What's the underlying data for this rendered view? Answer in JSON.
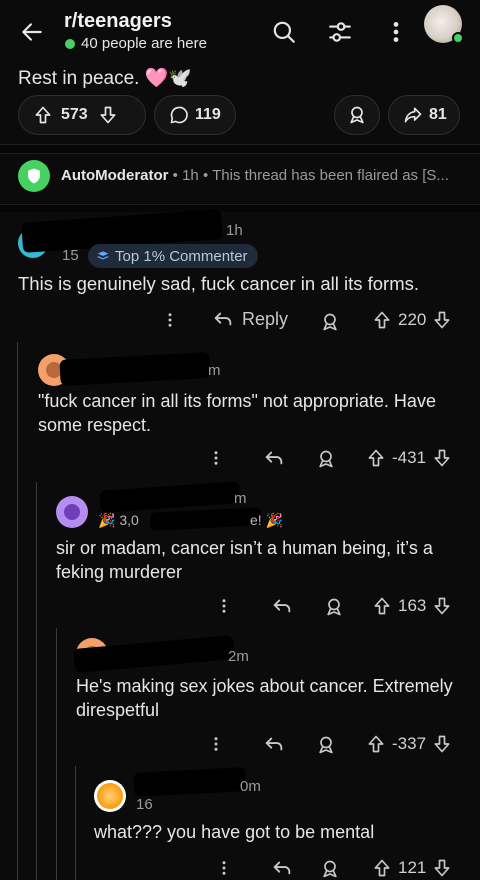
{
  "header": {
    "back_icon": "arrow-left-icon",
    "subreddit": "r/teenagers",
    "online": "40 people are here",
    "online_color": "#46d160",
    "search_icon": "search-icon",
    "filter_icon": "sliders-icon",
    "menu_icon": "more-vertical-icon"
  },
  "post": {
    "body_tail": "Rest in peace. 🩷🕊️",
    "upvotes": "573",
    "comments": "119",
    "shares": "81"
  },
  "automod": {
    "name": "AutoModerator",
    "meta": " • 1h • This thread has been flaired as [S..."
  },
  "comments": [
    {
      "time": "1h",
      "karma": "15",
      "badge": "Top 1% Commenter",
      "text": "This is genuinely sad, fuck cancer in all its forms.",
      "reply_label": "Reply",
      "score": "220"
    },
    {
      "time": "m",
      "text": "\"fuck cancer in all its forms\" not appropriate. Have some respect.",
      "score": "-431"
    },
    {
      "time": "m",
      "badge_partial": "🎉 3,0",
      "badge_partial2": "e! 🎉",
      "text": "sir or madam, cancer isn’t a human being, it’s a feking murderer",
      "score": "163"
    },
    {
      "time": "2m",
      "text": "He's making sex jokes about cancer. Extremely direspetful",
      "score": "-337"
    },
    {
      "time": "0m",
      "karma": "16",
      "text": "what??? you have got to be mental",
      "score": "121"
    }
  ],
  "colors": {
    "background": "#0b0b0b",
    "automod_green": "#46d160",
    "badge_bg": "#1f2a3a"
  }
}
